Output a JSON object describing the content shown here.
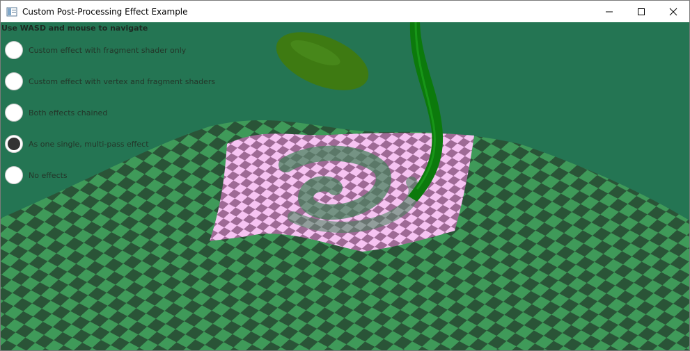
{
  "window": {
    "title": "Custom Post-Processing Effect Example",
    "controls": {
      "minimize": "minimize-icon",
      "maximize": "maximize-icon",
      "close": "close-icon"
    }
  },
  "viewport": {
    "hint": "Use WASD and mouse to navigate",
    "background_color": "#247553",
    "floor_colors": [
      "#2a5437",
      "#3f9a59"
    ],
    "pink_patch_colors": [
      "#f6c3f2",
      "#9e6a95"
    ],
    "plant_color": "#0c7a0c"
  },
  "effects": {
    "selected_index": 3,
    "options": [
      {
        "label": "Custom effect with fragment shader only"
      },
      {
        "label": "Custom effect with vertex and fragment shaders"
      },
      {
        "label": "Both effects chained"
      },
      {
        "label": "As one single, multi-pass effect"
      },
      {
        "label": "No effects"
      }
    ]
  }
}
